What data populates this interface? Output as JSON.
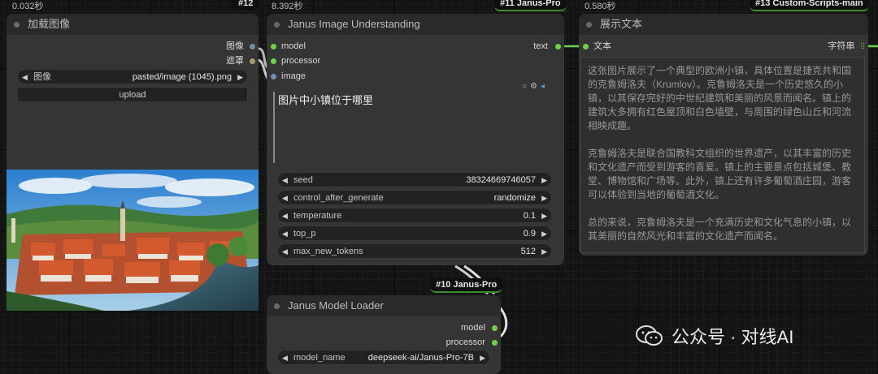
{
  "colors": {
    "background": "#141414",
    "node_body": "#353535",
    "node_title": "#2a2a2a",
    "port_green": "#6fd14a",
    "port_blue": "#6f8fb1",
    "link_white": "#e6e6e6"
  },
  "load_image_node": {
    "timing": "0.032秒",
    "badge": "#12",
    "title": "加载图像",
    "outputs": [
      "图像",
      "遮罩"
    ],
    "image_widget": {
      "name": "图像",
      "value": "pasted/image (1045).png"
    },
    "upload_label": "upload",
    "image_icon": "castle-town-photo"
  },
  "janus_understanding_node": {
    "timing": "8.392秒",
    "badge": "#11 Janus-Pro",
    "title": "Janus Image Understanding",
    "inputs": [
      "model",
      "processor",
      "image"
    ],
    "output": "text",
    "prompt": "图片中小镇位于哪里",
    "widgets": [
      {
        "name": "seed",
        "value": "38324669746057"
      },
      {
        "name": "control_after_generate",
        "value": "randomize"
      },
      {
        "name": "temperature",
        "value": "0.1"
      },
      {
        "name": "top_p",
        "value": "0.9"
      },
      {
        "name": "max_new_tokens",
        "value": "512"
      }
    ]
  },
  "show_text_node": {
    "timing": "0.580秒",
    "badge": "#13 Custom-Scripts-main",
    "title": "展示文本",
    "input": "文本",
    "output": "字符串",
    "text": "这张图片展示了一个典型的欧洲小镇，具体位置是捷克共和国的克鲁姆洛夫（Krumlov）。克鲁姆洛夫是一个历史悠久的小镇，以其保存完好的中世纪建筑和美丽的风景而闻名。镇上的建筑大多拥有红色屋顶和白色墙壁，与周围的绿色山丘和河流相映成趣。\n\n克鲁姆洛夫是联合国教科文组织的世界遗产，以其丰富的历史和文化遗产而受到游客的喜爱。镇上的主要景点包括城堡、教堂、博物馆和广场等。此外，镇上还有许多葡萄酒庄园，游客可以体验到当地的葡萄酒文化。\n\n总的来说，克鲁姆洛夫是一个充满历史和文化气息的小镇，以其美丽的自然风光和丰富的文化遗产而闻名。"
  },
  "model_loader_node": {
    "badge": "#10 Janus-Pro",
    "title": "Janus Model Loader",
    "outputs": [
      "model",
      "processor"
    ],
    "widget": {
      "name": "model_name",
      "value": "deepseek-ai/Janus-Pro-7B"
    }
  },
  "watermark": "公众号 · 对线AI"
}
